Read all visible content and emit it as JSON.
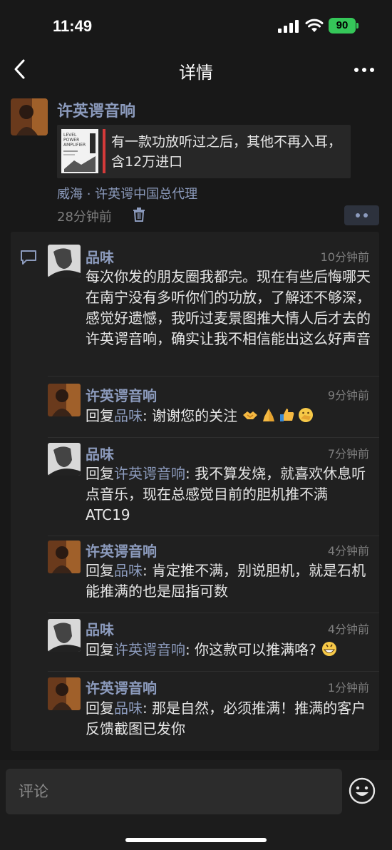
{
  "status_bar": {
    "time": "11:49",
    "battery": "90"
  },
  "nav": {
    "title": "详情"
  },
  "post": {
    "author": "许英谔音响",
    "share_text": "有一款功放听过之后，其他不再入耳，含12万进口",
    "thumb_lines": [
      "LEVEL",
      "POWER",
      "AMPLIFIER"
    ],
    "location": "威海 · 许英谔中国总代理",
    "time": "28分钟前"
  },
  "comments": [
    {
      "name": "品味",
      "time": "10分钟前",
      "avatar": "pinwei",
      "text": "每次你发的朋友圈我都完。现在有些后悔哪天在南宁没有多听你们的功放，了解还不够深，感觉好遗憾，我听过麦景图推大情人后才去的许英谔音响，确实让我不相信能出这么好声音"
    },
    {
      "name": "许英谔音响",
      "time": "9分钟前",
      "avatar": "xu",
      "reply_prefix": "回复",
      "reply_to": "品味",
      "text": ": 谢谢您的关注"
    },
    {
      "name": "品味",
      "time": "7分钟前",
      "avatar": "pinwei",
      "reply_prefix": "回复",
      "reply_to": "许英谔音响",
      "text": ": 我不算发烧，就喜欢休息听点音乐，现在总感觉目前的胆机推不满 ATC19"
    },
    {
      "name": "许英谔音响",
      "time": "4分钟前",
      "avatar": "xu",
      "reply_prefix": "回复",
      "reply_to": "品味",
      "text": ": 肯定推不满，别说胆机，就是石机能推满的也是屈指可数"
    },
    {
      "name": "品味",
      "time": "4分钟前",
      "avatar": "pinwei",
      "reply_prefix": "回复",
      "reply_to": "许英谔音响",
      "text": ": 你这款可以推满咯?"
    },
    {
      "name": "许英谔音响",
      "time": "1分钟前",
      "avatar": "xu",
      "reply_prefix": "回复",
      "reply_to": "品味",
      "text": ": 那是自然，必须推满！推满的客户反馈截图已发你"
    }
  ],
  "input": {
    "placeholder": "评论"
  },
  "colors": {
    "link": "#8c9bbd",
    "background": "#181818",
    "panel": "#202020",
    "battery": "#35c759"
  }
}
